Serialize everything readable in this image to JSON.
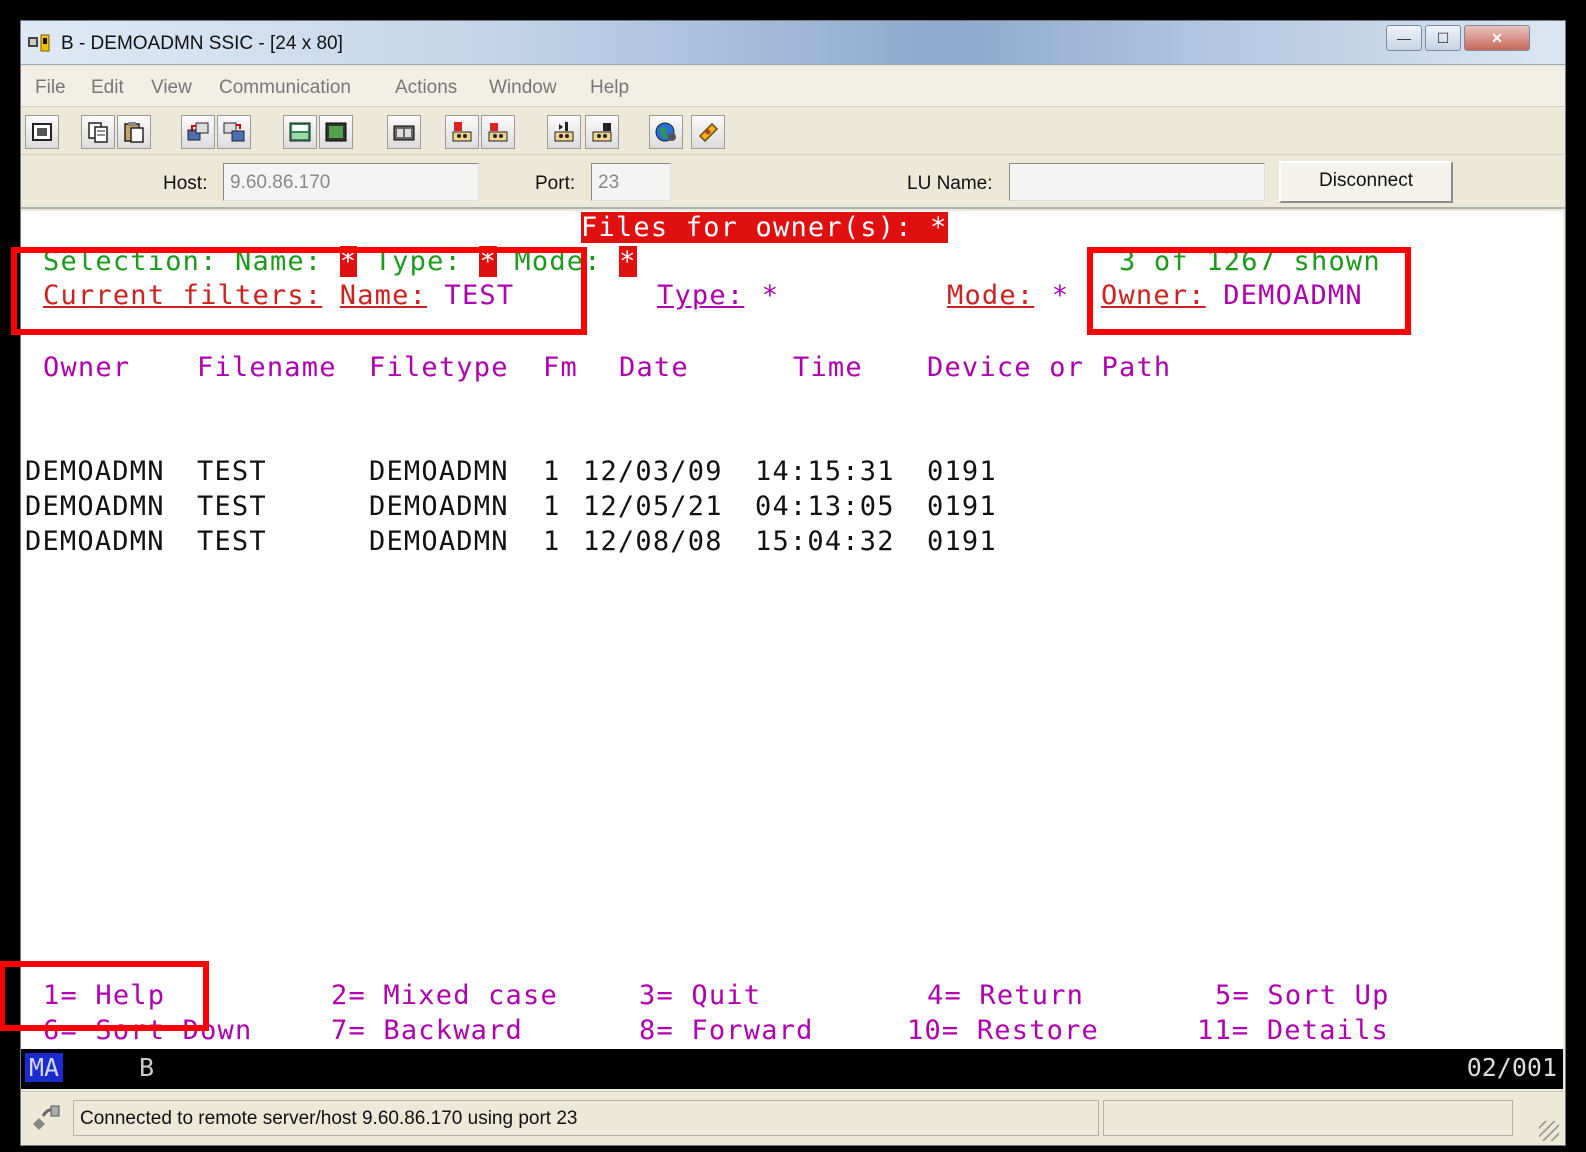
{
  "window": {
    "title": "B - DEMOADMN SSIC - [24 x 80]",
    "buttons": {
      "minimize": "—",
      "maximize": "☐",
      "close": "✕"
    }
  },
  "menu": [
    "File",
    "Edit",
    "View",
    "Communication",
    "Actions",
    "Window",
    "Help"
  ],
  "toolbar": {
    "icons": [
      "print-screen-icon",
      "copy-icon",
      "paste-icon",
      "send-file-icon",
      "receive-file-icon",
      "keypad-icon",
      "macro-icon",
      "record-icon",
      "play-macro-icon",
      "stop-macro-icon",
      "transfer-icon",
      "transfer-list-icon",
      "globe-icon",
      "help-icon"
    ]
  },
  "connection": {
    "host_label": "Host:",
    "host_value": "9.60.86.170",
    "port_label": "Port:",
    "port_value": "23",
    "lu_label": "LU Name:",
    "lu_value": "",
    "disconnect_label": "Disconnect"
  },
  "terminal": {
    "header": "Files for owner(s): *",
    "selection": {
      "label": "Selection:",
      "name_label": "Name:",
      "name_value": "*",
      "type_label": "Type:",
      "type_value": "*",
      "mode_label": "Mode:",
      "mode_value": "*",
      "shown": "3 of 1267 shown"
    },
    "filters": {
      "label": "Current filters:",
      "name_label": "Name:",
      "name_value": "TEST",
      "type_label": "Type:",
      "type_value": "*",
      "mode_label": "Mode:",
      "mode_value": "*",
      "owner_label": "Owner:",
      "owner_value": "DEMOADMN"
    },
    "columns": [
      "Owner",
      "Filename",
      "Filetype",
      "Fm",
      "Date",
      "Time",
      "Device or Path"
    ],
    "rows": [
      [
        "DEMOADMN",
        "TEST",
        "DEMOADMN",
        "1",
        "12/03/09",
        "14:15:31",
        "0191"
      ],
      [
        "DEMOADMN",
        "TEST",
        "DEMOADMN",
        "1",
        "12/05/21",
        "04:13:05",
        "0191"
      ],
      [
        "DEMOADMN",
        "TEST",
        "DEMOADMN",
        "1",
        "12/08/08",
        "15:04:32",
        "0191"
      ]
    ],
    "pf_keys_row1": [
      "1= Help",
      "2= Mixed case",
      "3= Quit",
      "4= Return",
      "5= Sort Up"
    ],
    "pf_keys_row2": [
      "6= Sort Down",
      "7= Backward",
      "8= Forward",
      "10= Restore",
      "11= Details"
    ]
  },
  "oia": {
    "ma": "MA",
    "session": "B",
    "cursor": "02/001"
  },
  "status": {
    "text": "Connected to remote server/host 9.60.86.170 using port 23"
  },
  "colors": {
    "green": "#1a9b1a",
    "magenta": "#b000b0",
    "red_highlight": "#ff0000",
    "header_bg": "#e01010"
  }
}
